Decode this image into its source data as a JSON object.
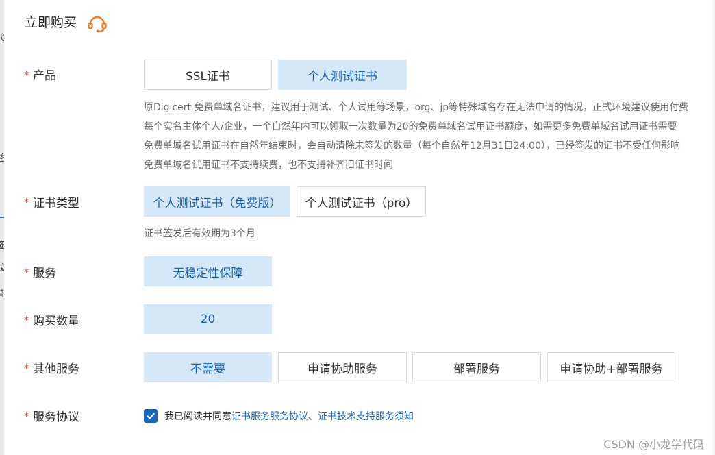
{
  "panel": {
    "title": "立即购买",
    "support_icon": "headset-icon"
  },
  "product": {
    "label": "产品",
    "options": [
      "SSL证书",
      "个人测试证书"
    ],
    "selected": "个人测试证书",
    "description": [
      "原Digicert 免费单域名证书，建议用于测试、个人试用等场景，org、jp等特殊域名存在无法申请的情况，正式环境建议使用付费",
      "每个实名主体个人/企业，一个自然年内可以领取一次数量为20的免费单域名试用证书额度，如需更多免费单域名试用证书需要",
      "免费单域名试用证书在自然年结束时，会自动清除未签发的数量（每个自然年12月31日24:00），已经签发的证书不受任何影响",
      "免费单域名试用证书不支持续费，也不支持补齐旧证书时间"
    ]
  },
  "cert_type": {
    "label": "证书类型",
    "options": [
      "个人测试证书（免费版）",
      "个人测试证书（pro）"
    ],
    "selected": "个人测试证书（免费版）",
    "hint": "证书签发后有效期为3个月"
  },
  "service": {
    "label": "服务",
    "options": [
      "无稳定性保障"
    ],
    "selected": "无稳定性保障"
  },
  "quantity": {
    "label": "购买数量",
    "value": "20"
  },
  "other_services": {
    "label": "其他服务",
    "options": [
      "不需要",
      "申请协助服务",
      "部署服务",
      "申请协助+部署服务"
    ],
    "selected": "不需要"
  },
  "agreement": {
    "label": "服务协议",
    "checked": true,
    "text": "我已阅读并同意",
    "link1": "证书服务服务协议",
    "separator": "、",
    "link2": "证书技术支持服务须知"
  },
  "left_edge": {
    "fragments": [
      "代",
      "益",
      "签",
      "成",
      "普"
    ]
  },
  "watermark": "CSDN @小龙学代码",
  "colors": {
    "accent": "#1b62b5",
    "selected_bg": "#d4e8f8",
    "required": "#e0473a",
    "icon_orange": "#f07c22",
    "checkbox": "#1668c2"
  }
}
